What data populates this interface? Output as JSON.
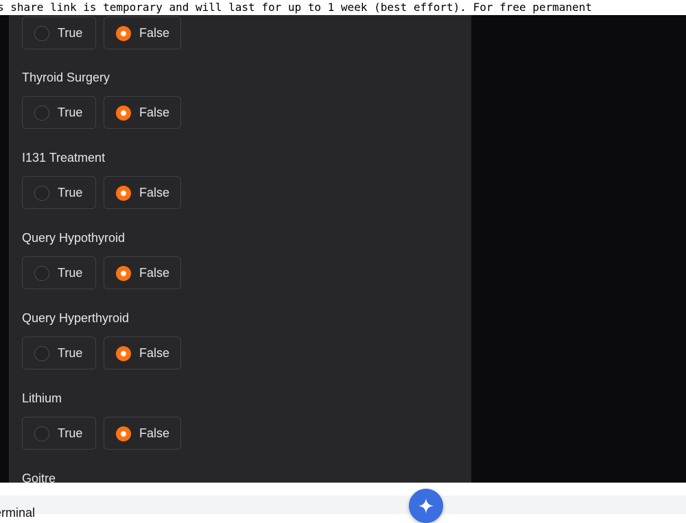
{
  "banner": {
    "text": "s share link is temporary and will last for up to 1 week (best effort). For free permanent"
  },
  "form": {
    "true_label": "True",
    "false_label": "False",
    "questions": [
      {
        "label": "",
        "selected": "False"
      },
      {
        "label": "Thyroid Surgery",
        "selected": "False"
      },
      {
        "label": "I131 Treatment",
        "selected": "False"
      },
      {
        "label": "Query Hypothyroid",
        "selected": "False"
      },
      {
        "label": "Query Hyperthyroid",
        "selected": "False"
      },
      {
        "label": "Lithium",
        "selected": "False"
      },
      {
        "label": "Goitre",
        "selected": null
      }
    ]
  },
  "bottom_bar": {
    "terminal_label": "erminal",
    "gemini_icon": "sparkle-icon"
  },
  "colors": {
    "accent": "#f97316",
    "panel": "#27272a",
    "background": "#0b0b0f",
    "gemini": "#3b6fe0"
  }
}
